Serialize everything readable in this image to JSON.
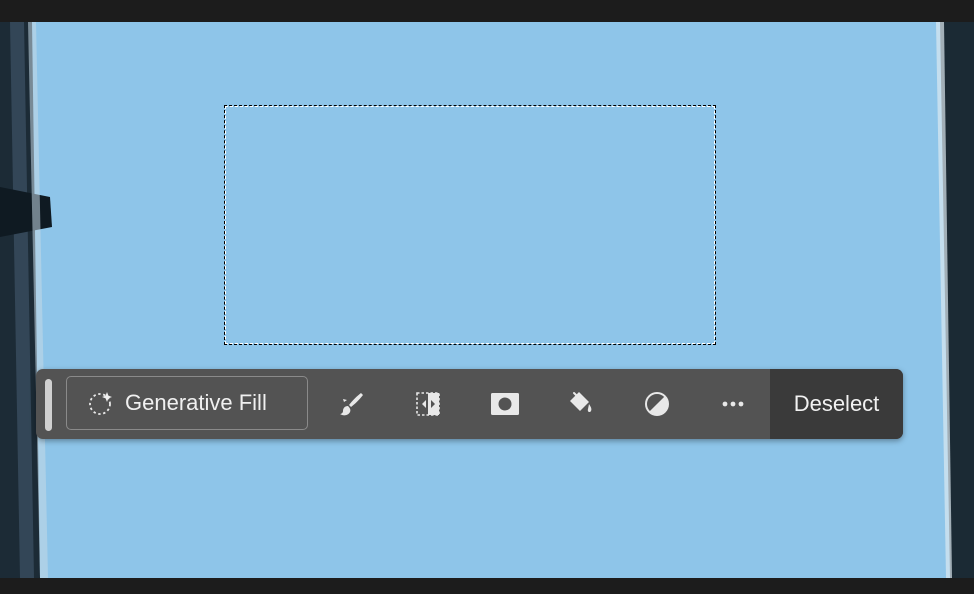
{
  "taskbar": {
    "generative_fill_label": "Generative Fill",
    "deselect_label": "Deselect",
    "tools": [
      {
        "icon": "brush-icon",
        "tooltip": ""
      },
      {
        "icon": "transform-selection-icon",
        "tooltip": ""
      },
      {
        "icon": "mask-icon",
        "tooltip": ""
      },
      {
        "icon": "fill-bucket-icon",
        "tooltip": ""
      },
      {
        "icon": "adjustment-icon",
        "tooltip": ""
      },
      {
        "icon": "more-options-icon",
        "tooltip": ""
      }
    ]
  },
  "colors": {
    "canvas_sky": "#8dc4e8",
    "taskbar_bg": "#535353",
    "deselect_bg": "#3a3a3a",
    "app_frame": "#1e1e1e"
  }
}
